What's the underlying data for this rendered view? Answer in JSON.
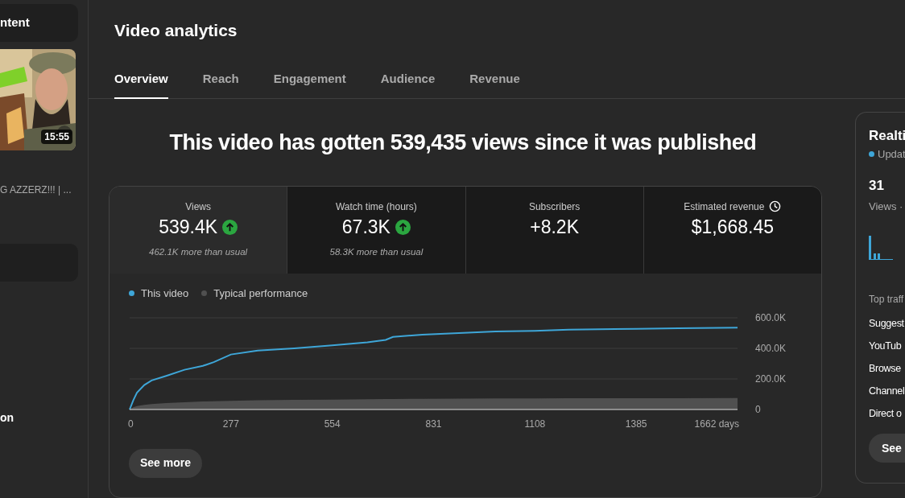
{
  "sidebar": {
    "header": "ntent",
    "video": {
      "duration": "15:55",
      "title": "G AZZERZ!!! | ..."
    },
    "nav_items": [
      {
        "label": "on"
      }
    ]
  },
  "page": {
    "title": "Video analytics"
  },
  "tabs": [
    {
      "label": "Overview",
      "selected": true
    },
    {
      "label": "Reach",
      "selected": false
    },
    {
      "label": "Engagement",
      "selected": false
    },
    {
      "label": "Audience",
      "selected": false
    },
    {
      "label": "Revenue",
      "selected": false
    }
  ],
  "headline": "This video has gotten 539,435 views since it was published",
  "metrics": [
    {
      "kind": "count",
      "label": "Views",
      "value": "539.4K",
      "trending_up": true,
      "note": "462.1K more than usual",
      "selected": true
    },
    {
      "kind": "count",
      "label": "Watch time (hours)",
      "value": "67.3K",
      "trending_up": true,
      "note": "58.3K more than usual",
      "selected": false
    },
    {
      "kind": "count",
      "label": "Subscribers",
      "value": "+8.2K",
      "selected": false
    },
    {
      "kind": "revenue",
      "label": "Estimated revenue",
      "value": "$1,668.45",
      "selected": false
    }
  ],
  "chart_data": {
    "type": "line",
    "x": [
      0,
      10,
      20,
      40,
      60,
      100,
      150,
      200,
      230,
      277,
      350,
      450,
      554,
      650,
      700,
      720,
      800,
      900,
      1000,
      1108,
      1200,
      1385,
      1500,
      1662
    ],
    "series": [
      {
        "name": "This video",
        "type": "line",
        "color": "#3ea6d8",
        "values": [
          0,
          60000,
          110000,
          160000,
          190000,
          220000,
          260000,
          285000,
          310000,
          360000,
          385000,
          400000,
          420000,
          440000,
          455000,
          475000,
          490000,
          500000,
          510000,
          515000,
          522000,
          528000,
          532000,
          535000
        ]
      },
      {
        "name": "Typical performance",
        "type": "area",
        "color": "#505050",
        "values": [
          0,
          15000,
          22000,
          30000,
          36000,
          42000,
          48000,
          52000,
          54000,
          57000,
          60000,
          63000,
          65000,
          67000,
          68000,
          69000,
          70000,
          71000,
          72000,
          72000,
          73000,
          74000,
          74000,
          75000
        ]
      }
    ],
    "xlim": [
      0,
      1662
    ],
    "ylim": [
      0,
      600000
    ],
    "xticks": [
      0,
      277,
      554,
      831,
      1108,
      1385,
      {
        "value": 1662,
        "label": "1662 days"
      }
    ],
    "yticks": [
      {
        "value": 0,
        "label": "0"
      },
      {
        "value": 200000,
        "label": "200.0K"
      },
      {
        "value": 400000,
        "label": "400.0K"
      },
      {
        "value": 600000,
        "label": "600.0K"
      }
    ]
  },
  "see_more": "See more",
  "realtime": {
    "title": "Realti",
    "status": "Updat",
    "value": "31",
    "caption": "Views ·",
    "section": "Top traff",
    "sources": [
      "Suggest",
      "YouTub",
      "Browse",
      "Channel",
      "Direct o"
    ],
    "button": "See"
  }
}
